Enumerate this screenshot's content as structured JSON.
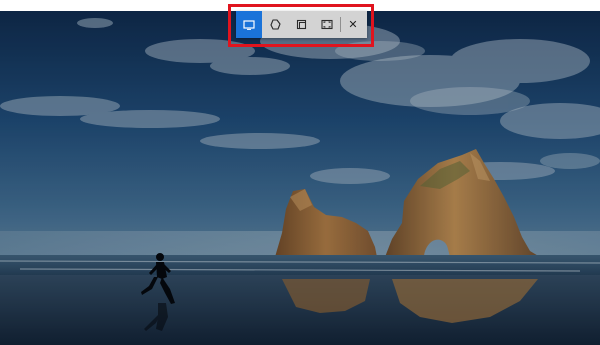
{
  "toolbar": {
    "active_mode": "rectangular-snip",
    "modes": [
      {
        "icon": "rectangle-snip-icon",
        "selected": true
      },
      {
        "icon": "freeform-snip-icon",
        "selected": false
      },
      {
        "icon": "window-snip-icon",
        "selected": false
      },
      {
        "icon": "fullscreen-snip-icon",
        "selected": false
      }
    ],
    "close_glyph": "✕",
    "accent_color": "#1a73d9",
    "highlight_color": "#e0141e"
  }
}
